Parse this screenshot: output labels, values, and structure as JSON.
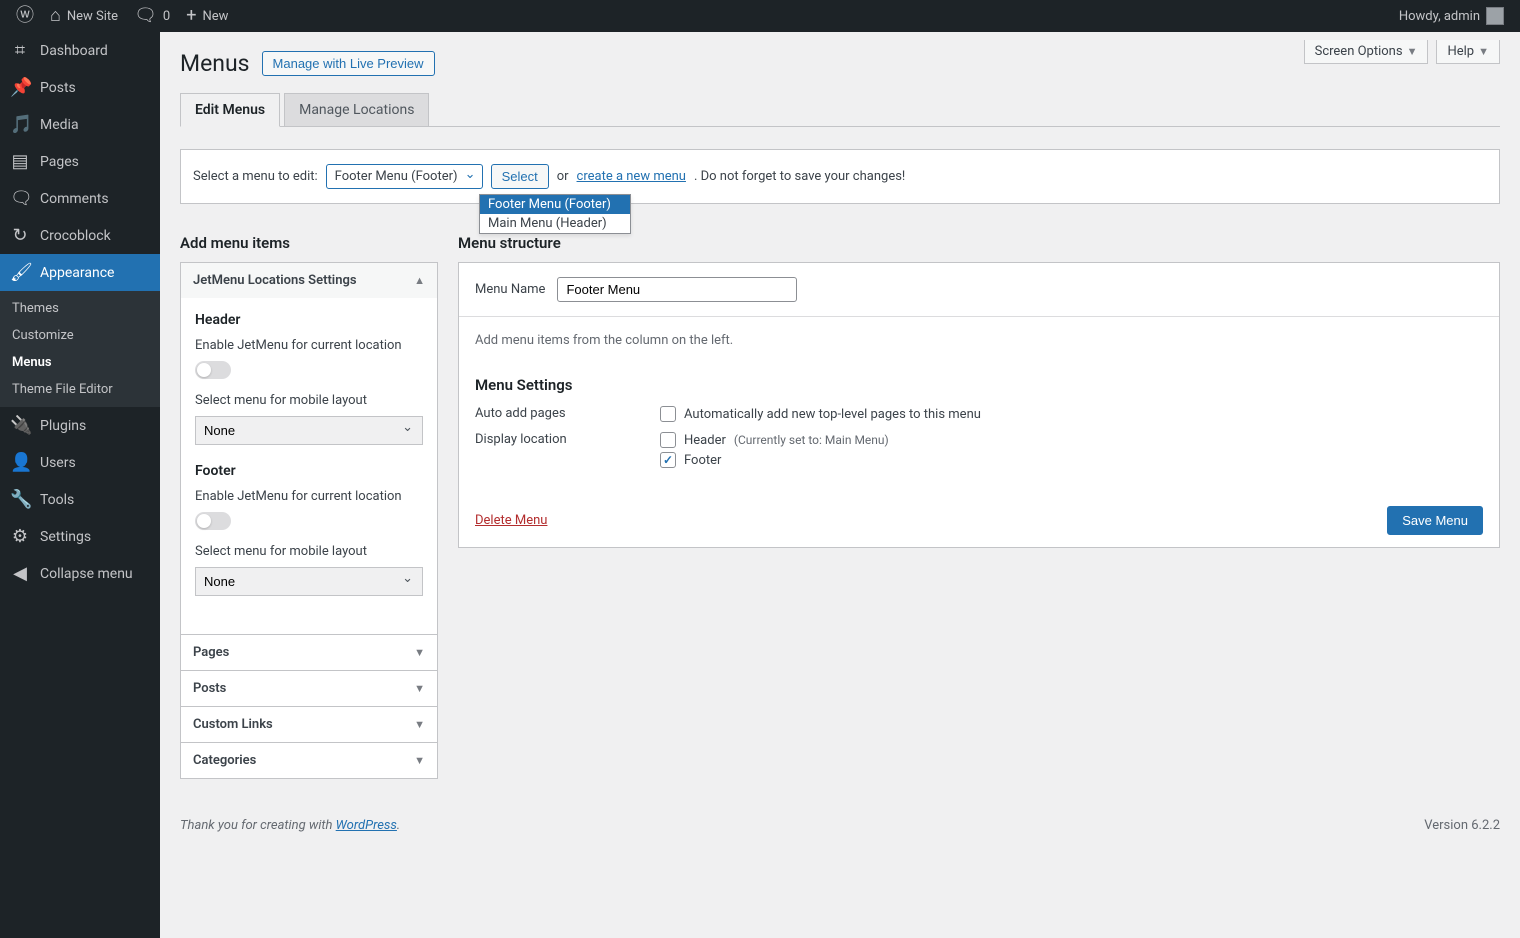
{
  "adminbar": {
    "site": "New Site",
    "comments": "0",
    "new": "New",
    "howdy": "Howdy, admin"
  },
  "adminmenu": {
    "dashboard": "Dashboard",
    "posts": "Posts",
    "media": "Media",
    "pages": "Pages",
    "comments": "Comments",
    "crocoblock": "Crocoblock",
    "appearance": "Appearance",
    "plugins": "Plugins",
    "users": "Users",
    "tools": "Tools",
    "settings": "Settings",
    "collapse": "Collapse menu",
    "sub": {
      "themes": "Themes",
      "customize": "Customize",
      "menus": "Menus",
      "editor": "Theme File Editor"
    }
  },
  "topbuttons": {
    "screen": "Screen Options",
    "help": "Help"
  },
  "page": {
    "title": "Menus",
    "preview_btn": "Manage with Live Preview",
    "tabs": {
      "edit": "Edit Menus",
      "manage": "Manage Locations"
    }
  },
  "selectrow": {
    "label": "Select a menu to edit:",
    "selected": "Footer Menu (Footer)",
    "options": [
      "Footer Menu (Footer)",
      "Main Menu (Header)"
    ],
    "select_btn": "Select",
    "or": "or",
    "create_link": "create a new menu",
    "after": ". Do not forget to save your changes!"
  },
  "add_items": {
    "title": "Add menu items",
    "jetmenu": {
      "title": "JetMenu Locations Settings",
      "header": "Header",
      "footer": "Footer",
      "enable": "Enable JetMenu for current location",
      "mobile": "Select menu for mobile layout",
      "none": "None"
    },
    "panels": {
      "pages": "Pages",
      "posts": "Posts",
      "custom": "Custom Links",
      "cats": "Categories"
    }
  },
  "structure": {
    "title": "Menu structure",
    "name_label": "Menu Name",
    "name_value": "Footer Menu",
    "hint": "Add menu items from the column on the left.",
    "settings_title": "Menu Settings",
    "auto_label": "Auto add pages",
    "auto_chk": "Automatically add new top-level pages to this menu",
    "loc_label": "Display location",
    "loc_header": "Header",
    "loc_header_sub": "(Currently set to: Main Menu)",
    "loc_footer": "Footer",
    "delete": "Delete Menu",
    "save": "Save Menu"
  },
  "footer": {
    "thanks_pre": "Thank you for creating with ",
    "wp": "WordPress",
    "version": "Version 6.2.2"
  }
}
